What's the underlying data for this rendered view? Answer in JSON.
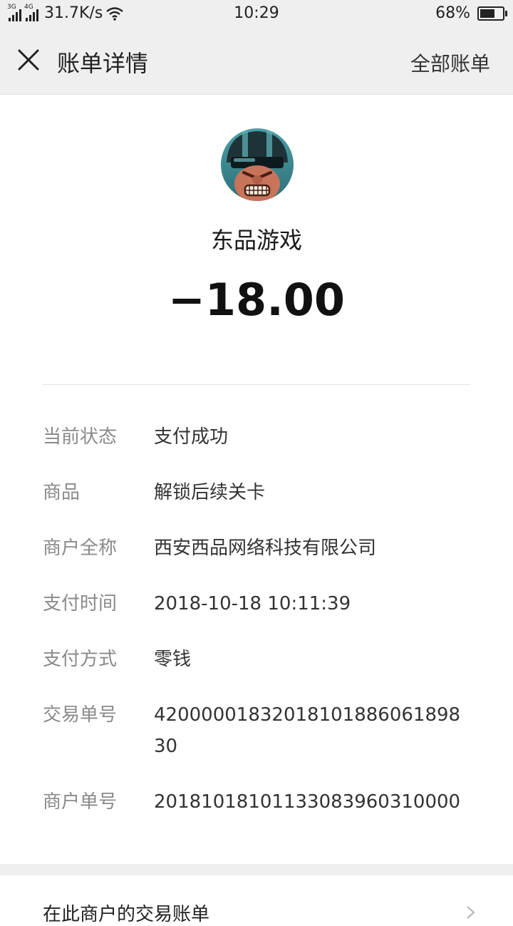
{
  "status_bar": {
    "signal1_label": "3G",
    "signal2_label": "4G",
    "speed": "31.7K/s",
    "time": "10:29",
    "battery": "68%",
    "battery_level": 0.68,
    "icons": [
      "signal-icon",
      "wifi-icon",
      "battery-icon"
    ]
  },
  "header": {
    "close_icon": "close-icon",
    "title": "账单详情",
    "all_bills": "全部账单"
  },
  "merchant": {
    "avatar_icon": "game-avatar-icon",
    "name": "东品游戏",
    "amount": "−18.00"
  },
  "details": [
    {
      "label": "当前状态",
      "value": "支付成功"
    },
    {
      "label": "商品",
      "value": "解锁后续关卡"
    },
    {
      "label": "商户全称",
      "value": "西安西品网络科技有限公司"
    },
    {
      "label": "支付时间",
      "value": "2018-10-18 10:11:39"
    },
    {
      "label": "支付方式",
      "value": "零钱"
    },
    {
      "label": "交易单号",
      "value": "4200000183201810188606189830"
    },
    {
      "label": "商户单号",
      "value": "20181018101133083960310000"
    }
  ],
  "footer": {
    "link": "在此商户的交易账单",
    "chevron_icon": "chevron-right-icon"
  },
  "colors": {
    "header_bg": "#efefef",
    "label_gray": "#8a8a8a",
    "value_text": "#333333"
  }
}
